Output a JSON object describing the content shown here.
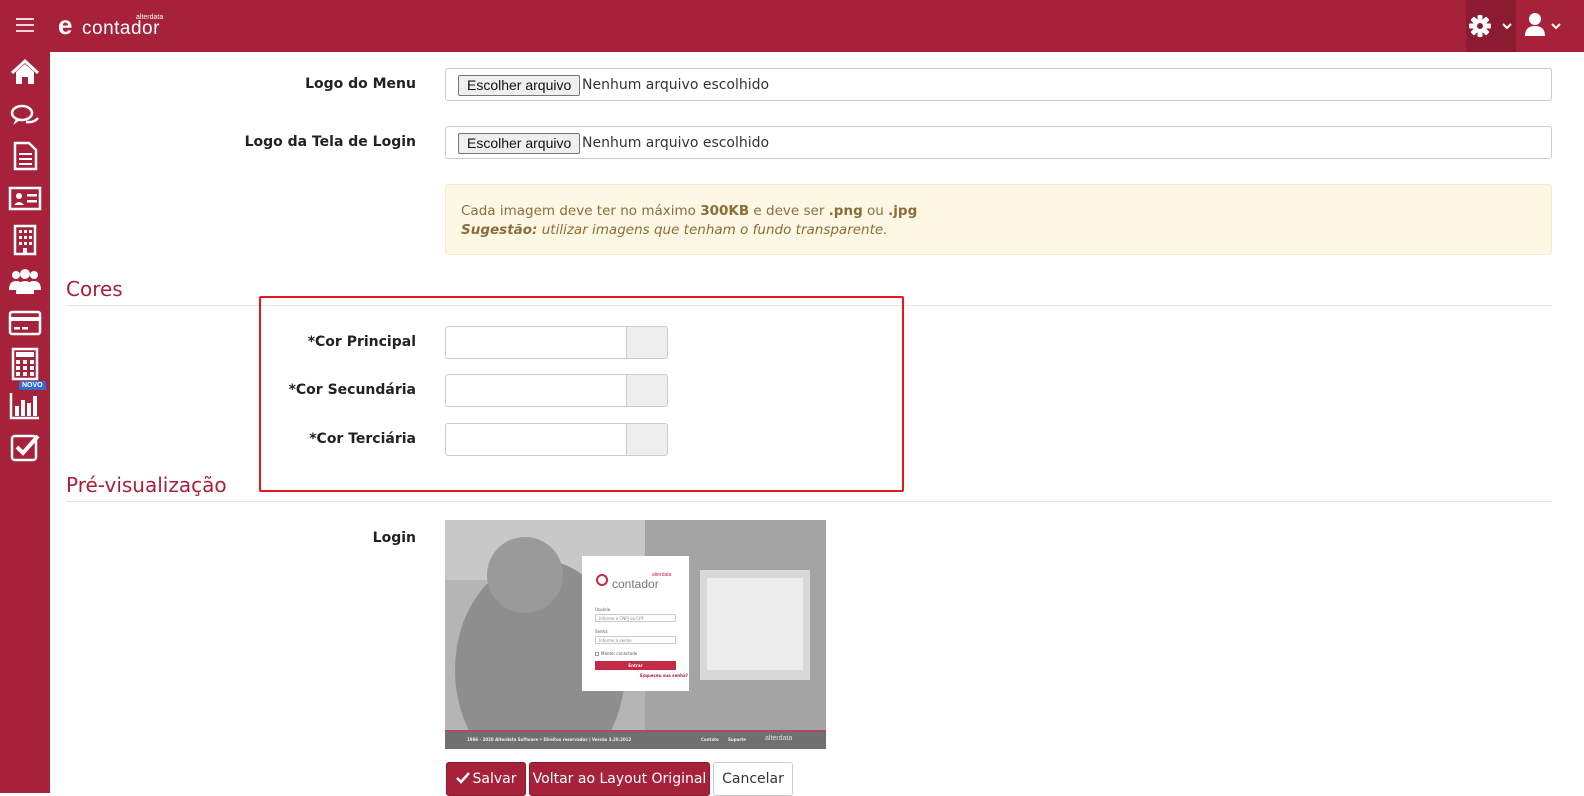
{
  "header": {
    "logo_e": "e",
    "logo_word": "contador",
    "logo_small": "alterdata",
    "settings_icon": "gear-icon",
    "user_icon": "user-icon"
  },
  "sidebar": {
    "items": [
      {
        "icon": "home-icon"
      },
      {
        "icon": "chat-icon"
      },
      {
        "icon": "document-icon"
      },
      {
        "icon": "contact-card-icon"
      },
      {
        "icon": "building-icon"
      },
      {
        "icon": "users-icon"
      },
      {
        "icon": "credit-card-icon"
      },
      {
        "icon": "calculator-icon"
      },
      {
        "icon": "bar-chart-icon"
      },
      {
        "icon": "checkbox-icon"
      }
    ],
    "novo_badge": "NOVO"
  },
  "logos": {
    "menu_label": "Logo do Menu",
    "login_label": "Logo da Tela de Login",
    "choose_button": "Escolher arquivo",
    "no_file": "Nenhum arquivo escolhido"
  },
  "alert": {
    "line1_a": "Cada imagem deve ter no máximo ",
    "line1_b": "300KB",
    "line1_c": " e deve ser ",
    "line1_d": ".png",
    "line1_e": " ou ",
    "line1_f": ".jpg",
    "line2_a": "Sugestão:",
    "line2_b": " utilizar imagens que tenham o fundo transparente."
  },
  "cores": {
    "title": "Cores",
    "principal_label": "*Cor Principal",
    "secundaria_label": "*Cor Secundária",
    "terciaria_label": "*Cor Terciária",
    "principal_value": "",
    "secundaria_value": "",
    "terciaria_value": ""
  },
  "preview": {
    "title": "Pré-visualização",
    "login_label": "Login",
    "card_logo_word": "contador",
    "card_logo_small": "alterdata",
    "user_label": "Usuário",
    "user_placeholder": "Informe o CNPJ ou CPF",
    "password_label": "Senha",
    "password_placeholder": "Informe a senha",
    "remember_label": "Manter conectado",
    "enter_button": "Entrar",
    "forgot_link": "Esqueceu sua senha?",
    "footer_left": "1986 - 2020 Alterdata Software • Direitos reservados | Versão 3.20.2012",
    "footer_contact": "Contato",
    "footer_support": "Suporte",
    "footer_brand": "alterdata"
  },
  "actions": {
    "save": "Salvar",
    "restore": "Voltar ao Layout Original",
    "cancel": "Cancelar"
  },
  "colors": {
    "brand": "#a6213a",
    "brand_dark": "#8c1a30",
    "highlight_border": "#e8161f",
    "alert_bg": "#fcf8e3"
  }
}
